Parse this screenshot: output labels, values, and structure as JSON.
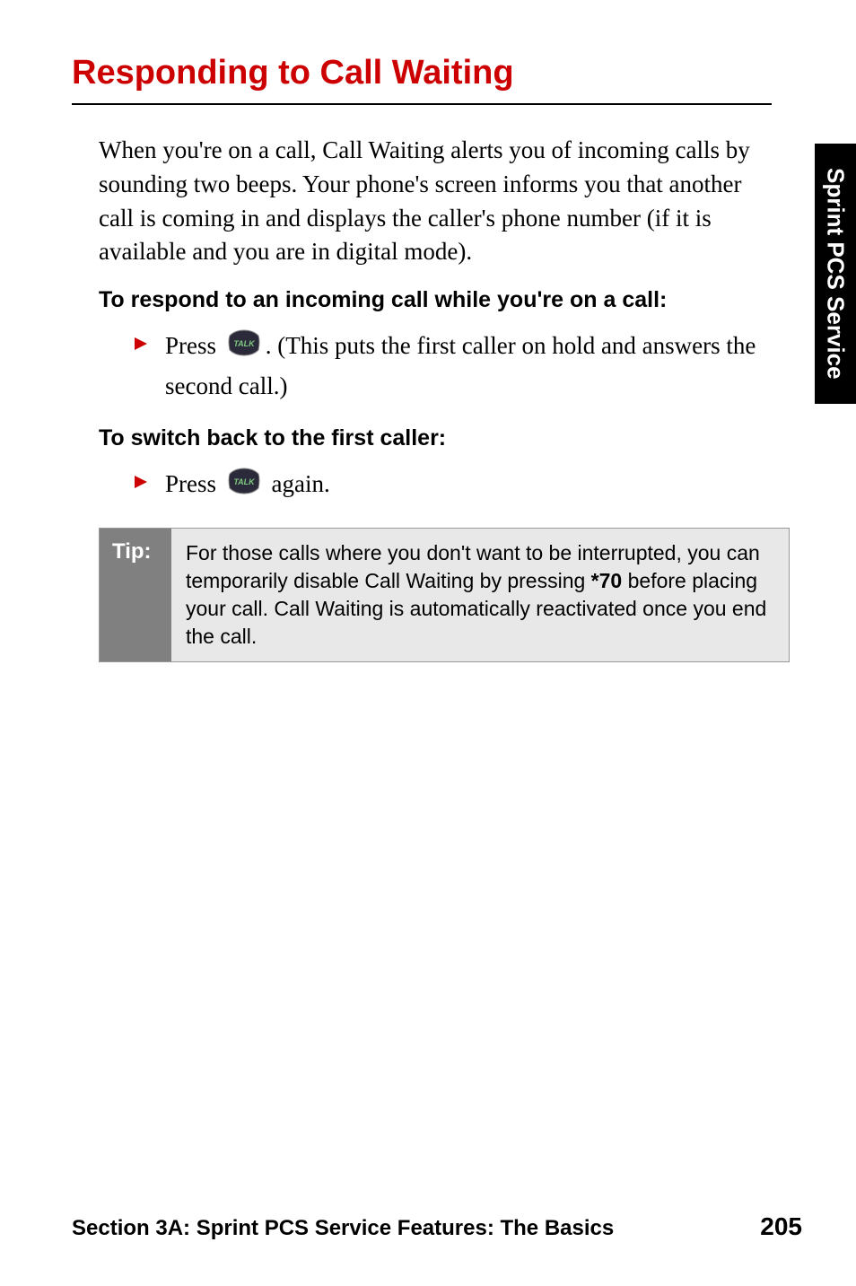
{
  "heading": "Responding to Call Waiting",
  "intro_paragraph": "When you're on a call, Call Waiting alerts you of incoming calls by sounding two beeps. Your phone's screen informs you that another call is coming in and displays the caller's phone number (if it is available and you are in digital mode).",
  "subheading_1": "To respond to an incoming call while you're on a call:",
  "bullet_1_before": "Press ",
  "bullet_1_after": ". (This puts the first caller on hold and answers the second call.)",
  "subheading_2": "To switch back to the first caller:",
  "bullet_2_before": "Press ",
  "bullet_2_after": " again.",
  "tip_label": "Tip:",
  "tip_text_before": "For those calls where you don't want to be interrupted, you can temporarily disable Call Waiting by pressing ",
  "tip_code": "*70",
  "tip_text_after": " before placing your call. Call Waiting is automatically reactivated once you end the call.",
  "side_tab": "Sprint PCS Service",
  "footer_section": "Section 3A: Sprint PCS Service Features: The Basics",
  "footer_page": "205",
  "talk_button_label": "TALK"
}
